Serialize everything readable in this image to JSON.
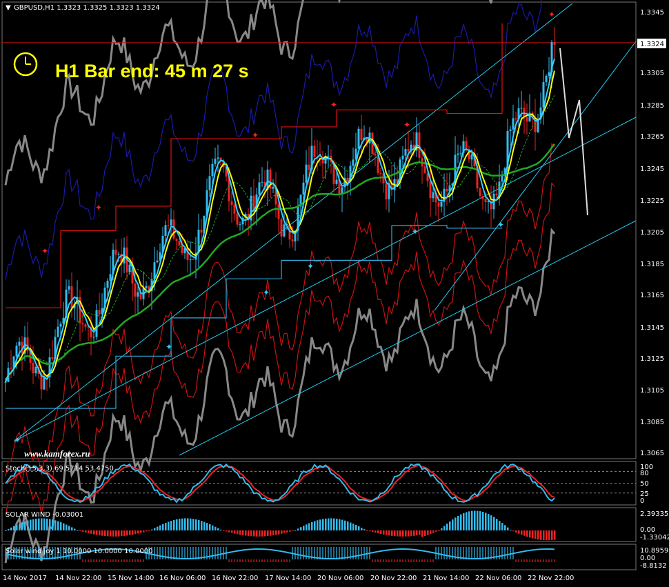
{
  "header": {
    "symbol_line": "GBPUSD,H1  1.3323 1.3325 1.3323 1.3324"
  },
  "timer": {
    "label": "H1 Bar end: 45 m 27 s"
  },
  "watermark": "www.kamforex.ru",
  "price_axis": {
    "ticks": [
      "1.3345",
      "1.3324",
      "1.3305",
      "1.3285",
      "1.3265",
      "1.3245",
      "1.3225",
      "1.3205",
      "1.3185",
      "1.3165",
      "1.3145",
      "1.3125",
      "1.3105",
      "1.3085",
      "1.3065"
    ],
    "current": "1.3324"
  },
  "time_axis": [
    "14 Nov 2017",
    "14 Nov 22:00",
    "15 Nov 14:00",
    "16 Nov 06:00",
    "16 Nov 22:00",
    "17 Nov 14:00",
    "20 Nov 06:00",
    "20 Nov 22:00",
    "21 Nov 14:00",
    "22 Nov 06:00",
    "22 Nov 22:00"
  ],
  "panels": {
    "stoch": {
      "label": "Stoch(15,3,3) 69.5714 53.4750",
      "ticks": [
        "100",
        "80",
        "50",
        "25",
        "0"
      ]
    },
    "solar": {
      "label": "SOLAR WIND -0.03001",
      "ticks": [
        "2.39335",
        "0.00",
        "-1.33042"
      ]
    },
    "solar_joy": {
      "label": "Solar wind joy 1 10.0000 10.0000 10.0000",
      "ticks": [
        "10.8959",
        "0.00",
        "-8.8132"
      ]
    }
  },
  "colors": {
    "bull": "#33bbee",
    "bear": "#ee2222",
    "ma_fast": "#ffff00",
    "ma_cyan": "#33ccff",
    "ma_green": "#22aa22",
    "band_blue": "#1a1aaa",
    "band_red": "#cc1111",
    "band_gray": "#888888"
  },
  "chart_data": [
    {
      "type": "candlestick",
      "symbol": "GBPUSD",
      "timeframe": "H1",
      "ylim": [
        1.3065,
        1.3345
      ],
      "anchor_closes": [
        [
          "14 Nov 2017",
          1.311
        ],
        [
          "14 Nov 22:00",
          1.314
        ],
        [
          "15 Nov 14:00",
          1.3175
        ],
        [
          "16 Nov 06:00",
          1.319
        ],
        [
          "16 Nov 22:00",
          1.3235
        ],
        [
          "17 Nov 14:00",
          1.3215
        ],
        [
          "20 Nov 06:00",
          1.3255
        ],
        [
          "20 Nov 22:00",
          1.325
        ],
        [
          "21 Nov 14:00",
          1.324
        ],
        [
          "22 Nov 06:00",
          1.3235
        ],
        [
          "22 Nov 22:00",
          1.3324
        ]
      ],
      "last": {
        "open": 1.3323,
        "high": 1.3325,
        "low": 1.3323,
        "close": 1.3324
      }
    },
    {
      "type": "line",
      "title": "Stoch(15,3,3)",
      "ylim": [
        0,
        100
      ],
      "series": [
        {
          "name": "main",
          "last": 69.5714
        },
        {
          "name": "signal",
          "last": 53.475
        }
      ]
    },
    {
      "type": "bar",
      "title": "SOLAR WIND",
      "ylim": [
        -1.33042,
        2.39335
      ],
      "last": -0.03001
    },
    {
      "type": "bar",
      "title": "Solar wind joy",
      "ylim": [
        -8.8132,
        10.8959
      ]
    }
  ]
}
